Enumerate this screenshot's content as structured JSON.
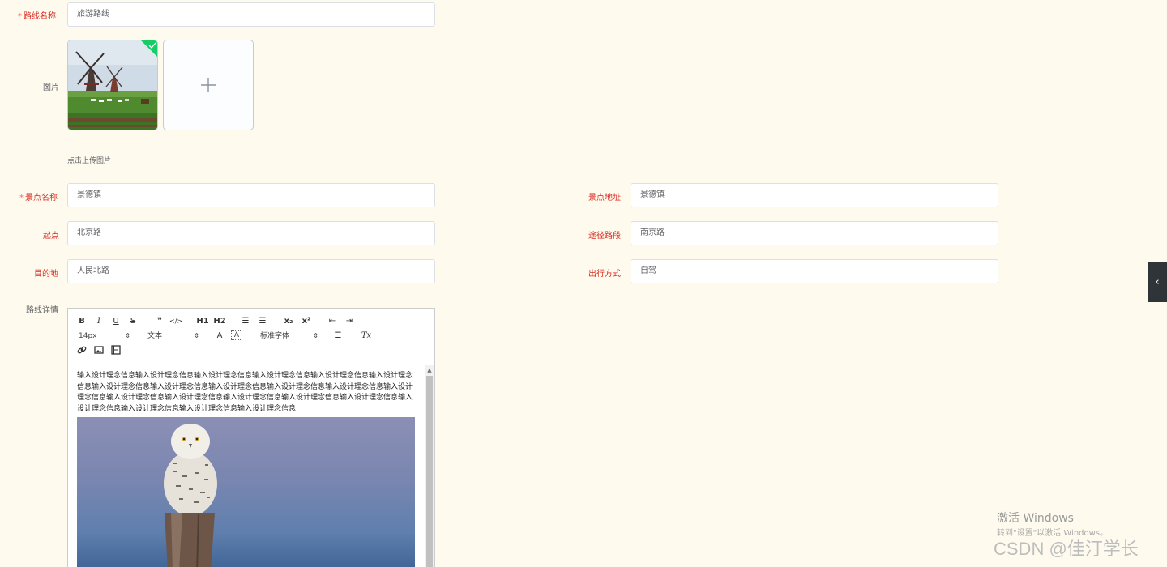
{
  "form": {
    "route_name": {
      "label": "路线名称",
      "required": true,
      "value": "旅游路线"
    },
    "image": {
      "label": "图片",
      "hint": "点击上传图片",
      "add_icon": "plus-icon"
    },
    "spot_name": {
      "label": "景点名称",
      "required": true,
      "value": "景德镇"
    },
    "spot_address": {
      "label": "景点地址",
      "value": "景德镇"
    },
    "start": {
      "label": "起点",
      "value": "北京路"
    },
    "via": {
      "label": "途径路段",
      "value": "南京路"
    },
    "destination": {
      "label": "目的地",
      "value": "人民北路"
    },
    "travel_mode": {
      "label": "出行方式",
      "value": "自驾"
    },
    "details": {
      "label": "路线详情"
    }
  },
  "editor": {
    "toolbar": {
      "bold": "B",
      "italic": "I",
      "underline": "U",
      "strike": "S",
      "quote": "❞",
      "code": "</>",
      "h1": "H1",
      "h2": "H2",
      "ordered_list": "☰",
      "bullet_list": "☰",
      "subscript": "x₂",
      "superscript": "x²",
      "indent_dec": "⇤",
      "indent_inc": "⇥",
      "size": "14px",
      "style": "文本",
      "font": "标准字体",
      "color": "A",
      "bg_color": "A",
      "align": "☰",
      "clean": "Tx",
      "link": "🔗",
      "image": "▣",
      "video": "▤",
      "select_arrow": "⇕"
    },
    "content_text": "输入设计理念信息输入设计理念信息输入设计理念信息输入设计理念信息输入设计理念信息输入设计理念信息输入设计理念信息输入设计理念信息输入设计理念信息输入设计理念信息输入设计理念信息输入设计理念信息输入设计理念信息输入设计理念信息输入设计理念信息输入设计理念信息输入设计理念信息输入设计理念信息输入设计理念信息输入设计理念信息输入设计理念信息",
    "scroll_up": "▲"
  },
  "side_toggle": "‹",
  "watermark": {
    "activate_title": "激活 Windows",
    "activate_sub": "转到\"设置\"以激活 Windows。",
    "csdn": "CSDN @佳汀学长"
  }
}
